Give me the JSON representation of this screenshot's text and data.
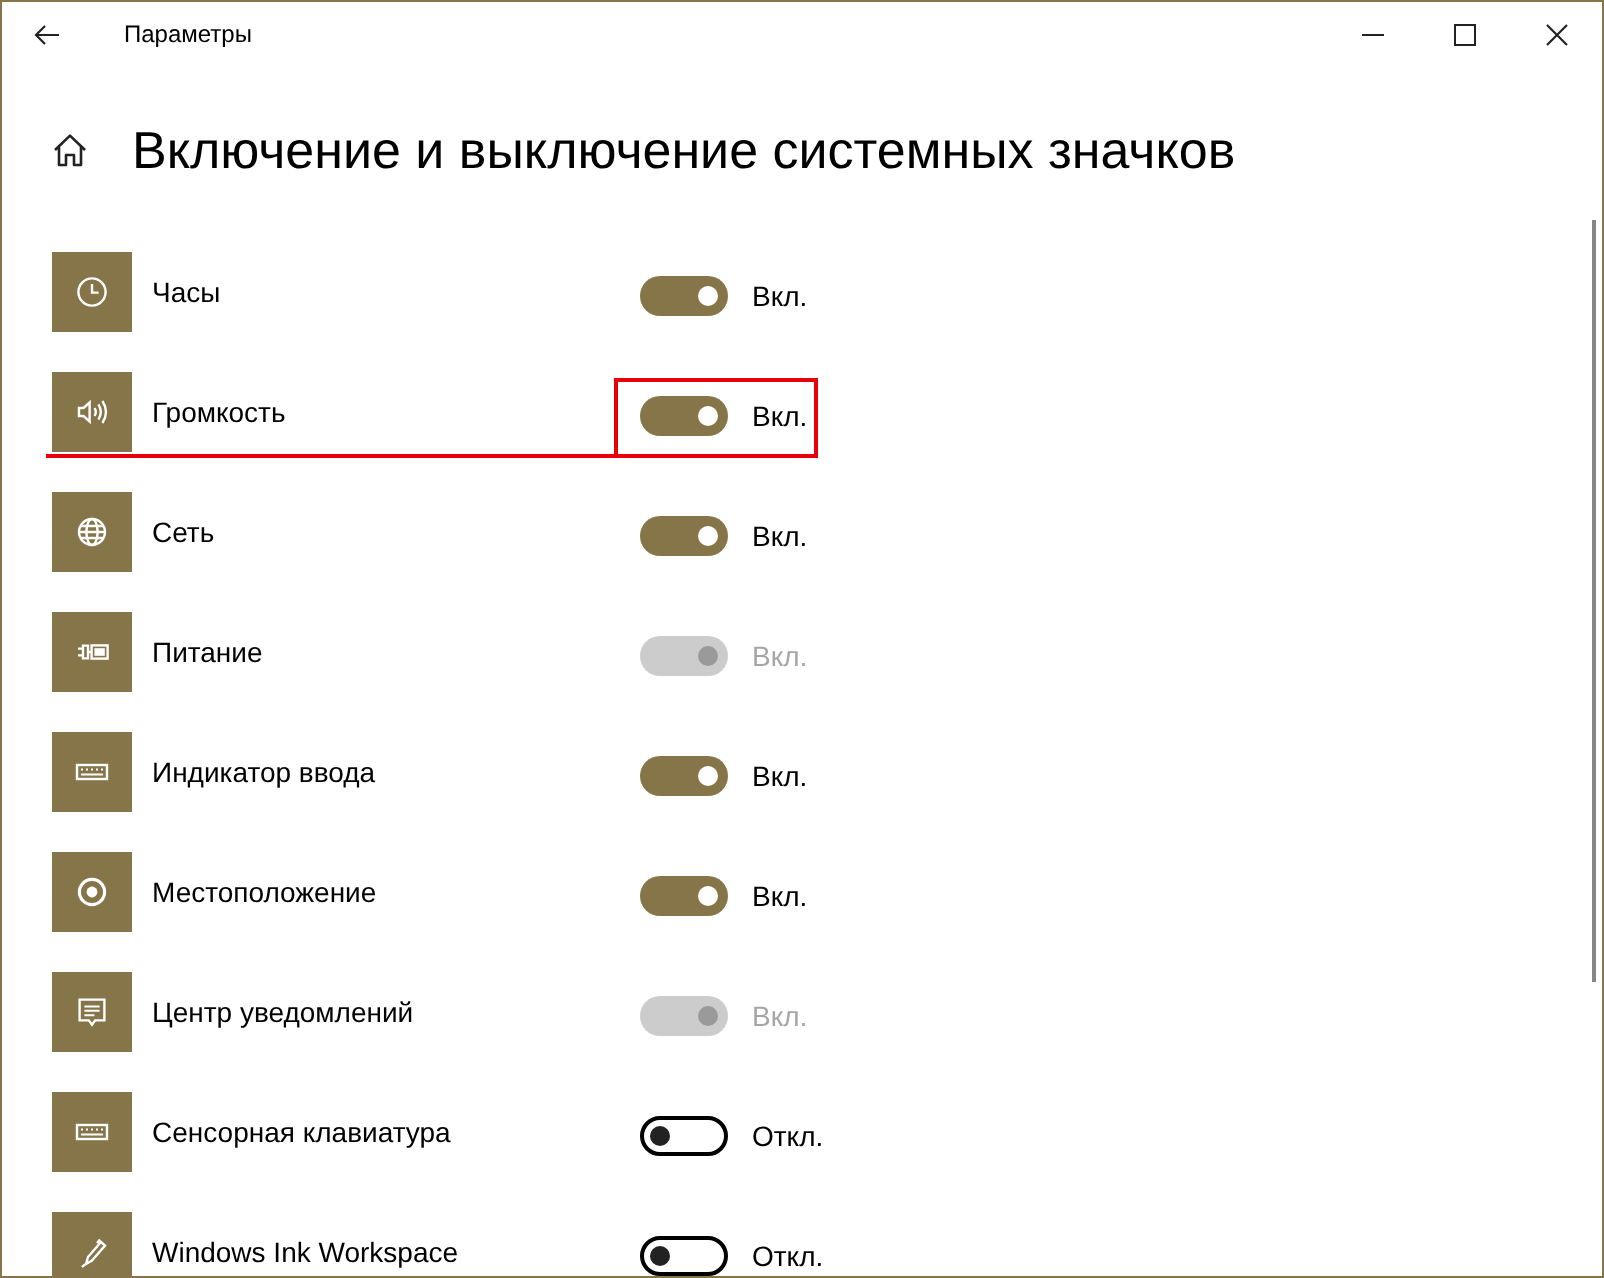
{
  "window": {
    "title": "Параметры"
  },
  "page": {
    "title": "Включение и выключение системных значков"
  },
  "items": [
    {
      "label": "Часы",
      "on": true,
      "disabled": false,
      "state_text": "Вкл.",
      "highlighted": false
    },
    {
      "label": "Громкость",
      "on": true,
      "disabled": false,
      "state_text": "Вкл.",
      "highlighted": true
    },
    {
      "label": "Сеть",
      "on": true,
      "disabled": false,
      "state_text": "Вкл.",
      "highlighted": false
    },
    {
      "label": "Питание",
      "on": true,
      "disabled": true,
      "state_text": "Вкл.",
      "highlighted": false
    },
    {
      "label": "Индикатор ввода",
      "on": true,
      "disabled": false,
      "state_text": "Вкл.",
      "highlighted": false
    },
    {
      "label": "Местоположение",
      "on": true,
      "disabled": false,
      "state_text": "Вкл.",
      "highlighted": false
    },
    {
      "label": "Центр уведомлений",
      "on": true,
      "disabled": true,
      "state_text": "Вкл.",
      "highlighted": false
    },
    {
      "label": "Сенсорная клавиатура",
      "on": false,
      "disabled": false,
      "state_text": "Откл.",
      "highlighted": false
    },
    {
      "label": "Windows Ink Workspace",
      "on": false,
      "disabled": false,
      "state_text": "Откл.",
      "highlighted": false
    }
  ]
}
